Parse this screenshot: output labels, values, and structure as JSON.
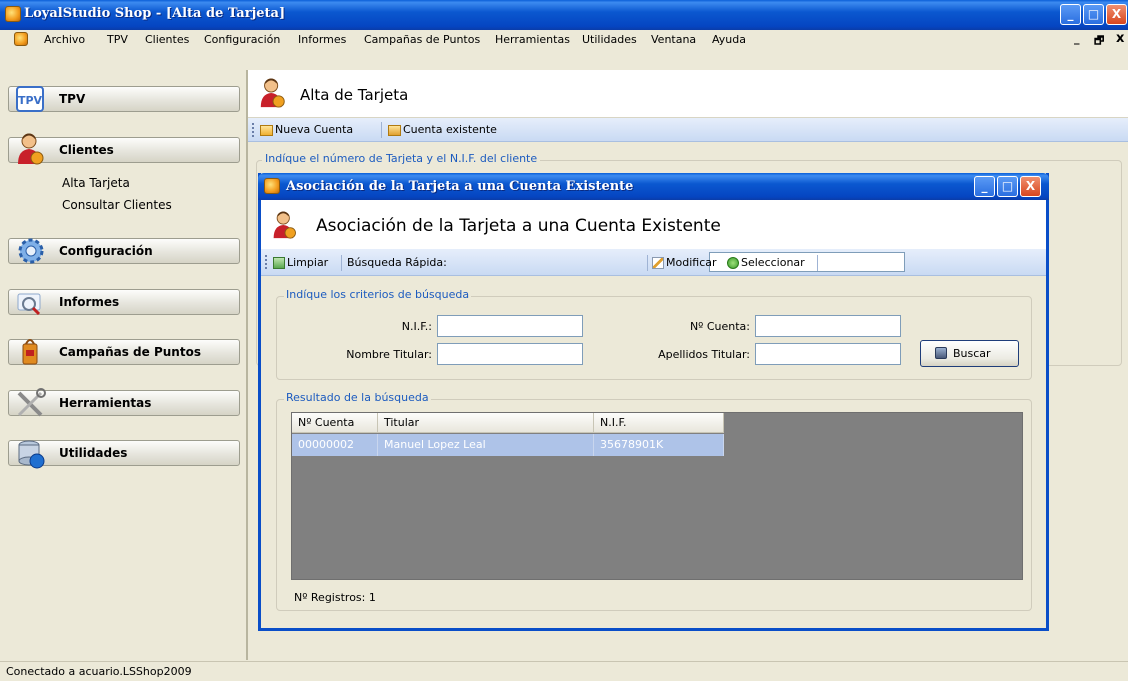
{
  "window": {
    "title": "LoyalStudio Shop - [Alta de Tarjeta]",
    "minimize": "_",
    "maximize": "□",
    "close": "X",
    "mdi_min": "_",
    "mdi_restore": "🗗",
    "mdi_close": "x"
  },
  "menu": [
    "Archivo",
    "TPV",
    "Clientes",
    "Configuración",
    "Informes",
    "Campañas de Puntos",
    "Herramientas",
    "Utilidades",
    "Ventana",
    "Ayuda"
  ],
  "sidebar": {
    "items": [
      {
        "label": "TPV"
      },
      {
        "label": "Clientes"
      },
      {
        "label": "Configuración"
      },
      {
        "label": "Informes"
      },
      {
        "label": "Campañas de Puntos"
      },
      {
        "label": "Herramientas"
      },
      {
        "label": "Utilidades"
      }
    ],
    "clientes_sub": [
      "Alta Tarjeta",
      "Consultar Clientes"
    ]
  },
  "main": {
    "title": "Alta de Tarjeta",
    "toolbar": {
      "nueva": "Nueva Cuenta",
      "existente": "Cuenta existente"
    },
    "group_legend": "Indíque el número de Tarjeta y el N.I.F. del cliente"
  },
  "dialog": {
    "window_title": "Asociación de la Tarjeta a una Cuenta Existente",
    "header_title": "Asociación de la Tarjeta a una Cuenta Existente",
    "toolbar": {
      "limpiar": "Limpiar",
      "busqueda_rapida": "Búsqueda Rápida:",
      "busqueda_value": "",
      "modificar": "Modificar",
      "seleccionar": "Seleccionar"
    },
    "criteria": {
      "legend": "Indíque los criterios de búsqueda",
      "nif_label": "N.I.F.:",
      "nif_value": "",
      "cuenta_label": "Nº Cuenta:",
      "cuenta_value": "",
      "nombre_label": "Nombre Titular:",
      "nombre_value": "",
      "apellidos_label": "Apellidos Titular:",
      "apellidos_value": "",
      "buscar": "Buscar"
    },
    "results": {
      "legend": "Resultado de la búsqueda",
      "columns": [
        "Nº Cuenta",
        "Titular",
        "N.I.F."
      ],
      "rows": [
        [
          "00000002",
          "Manuel Lopez Leal",
          "35678901K"
        ]
      ],
      "count": "Nº Registros: 1"
    }
  },
  "status": {
    "text": "Conectado a acuario.LSShop2009"
  },
  "colors": {
    "title_blue": "#0545c1",
    "accent_blue": "#1c5bbf",
    "selected_row": "#aec3e8",
    "grid_bg": "#808080"
  }
}
